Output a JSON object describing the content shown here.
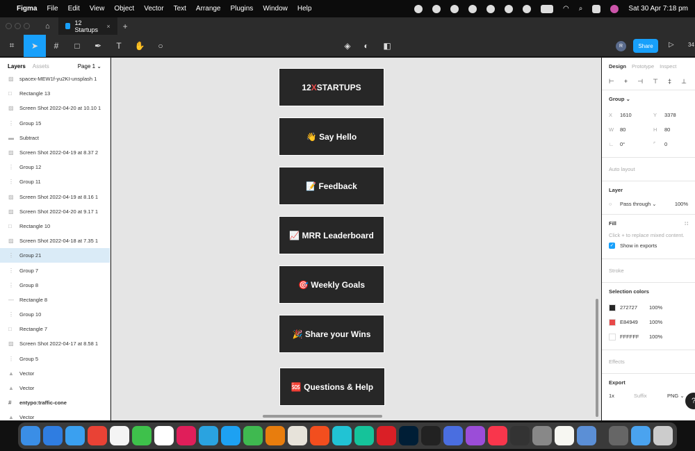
{
  "menubar": {
    "app": "Figma",
    "items": [
      "File",
      "Edit",
      "View",
      "Object",
      "Vector",
      "Text",
      "Arrange",
      "Plugins",
      "Window",
      "Help"
    ],
    "clock": "Sat 30 Apr  7:18 pm"
  },
  "tabbar": {
    "tab": "12 Startups",
    "close": "×",
    "add": "+"
  },
  "toolbar": {
    "share": "Share",
    "avatar": "R",
    "zoom": "34"
  },
  "left": {
    "tabs": [
      "Layers",
      "Assets"
    ],
    "page": "Page 1 ⌄",
    "layers": [
      {
        "name": "spacex-MEW1f-yu2KI-unsplash 1",
        "icon": "image-icon"
      },
      {
        "name": "Rectangle 13",
        "icon": "rectangle-icon"
      },
      {
        "name": "Screen Shot 2022-04-20 at 10.10 1",
        "icon": "image-icon"
      },
      {
        "name": "Group 15",
        "icon": "group-icon"
      },
      {
        "name": "Subtract",
        "icon": "subtract-icon"
      },
      {
        "name": "Screen Shot 2022-04-19 at 8.37 2",
        "icon": "image-icon"
      },
      {
        "name": "Group 12",
        "icon": "group-icon"
      },
      {
        "name": "Group 11",
        "icon": "group-icon"
      },
      {
        "name": "Screen Shot 2022-04-19 at 8.16 1",
        "icon": "image-icon"
      },
      {
        "name": "Screen Shot 2022-04-20 at 9.17 1",
        "icon": "image-icon"
      },
      {
        "name": "Rectangle 10",
        "icon": "rectangle-icon"
      },
      {
        "name": "Screen Shot 2022-04-18 at 7.35 1",
        "icon": "image-icon"
      },
      {
        "name": "Group 21",
        "icon": "group-icon",
        "selected": true
      },
      {
        "name": "Group 7",
        "icon": "group-icon"
      },
      {
        "name": "Group 8",
        "icon": "group-icon"
      },
      {
        "name": "Rectangle 8",
        "icon": "line-icon"
      },
      {
        "name": "Group 10",
        "icon": "group-icon"
      },
      {
        "name": "Rectangle 7",
        "icon": "rectangle-icon"
      },
      {
        "name": "Screen Shot 2022-04-17 at 8.58 1",
        "icon": "image-icon"
      },
      {
        "name": "Group 5",
        "icon": "group-icon"
      },
      {
        "name": "Vector",
        "icon": "vector-icon"
      },
      {
        "name": "Vector",
        "icon": "vector-icon"
      },
      {
        "name": "entypo:traffic-cone",
        "icon": "frame-icon"
      },
      {
        "name": "Vector",
        "icon": "vector-icon"
      }
    ]
  },
  "canvas": {
    "cards": [
      {
        "pre": "12",
        "x": "X",
        "post": "STARTUPS"
      },
      {
        "label": "👋 Say Hello"
      },
      {
        "label": "📝 Feedback"
      },
      {
        "label": "📈 MRR Leaderboard"
      },
      {
        "label": "🎯 Weekly Goals"
      },
      {
        "label": "🎉 Share your Wins"
      },
      {
        "label": "🆘 Questions & Help"
      }
    ]
  },
  "panel": {
    "tabs": [
      "Design",
      "Prototype",
      "Inspect"
    ],
    "group": "Group ⌄",
    "x_label": "X",
    "x": "1610",
    "y_label": "Y",
    "y": "3378",
    "w_label": "W",
    "w": "80",
    "h_label": "H",
    "h": "80",
    "rotation": "0°",
    "radius": "0",
    "auto_layout": "Auto layout",
    "layer": "Layer",
    "blend": "Pass through ⌄",
    "opacity": "100%",
    "fill": "Fill",
    "fill_hint": "Click + to replace mixed content.",
    "show_exports": "Show in exports",
    "stroke": "Stroke",
    "selection_colors": "Selection colors",
    "colors": [
      {
        "hex": "272727",
        "color": "#272727",
        "opacity": "100%"
      },
      {
        "hex": "E84949",
        "color": "#E84949",
        "opacity": "100%"
      },
      {
        "hex": "FFFFFF",
        "color": "#FFFFFF",
        "opacity": "100%"
      }
    ],
    "effects": "Effects",
    "export": "Export",
    "scale": "1x",
    "suffix": "Suffix",
    "format": "PNG ⌄",
    "help": "?"
  },
  "colors": {
    "accent": "#18a0fb",
    "brand_red": "#E84949"
  }
}
